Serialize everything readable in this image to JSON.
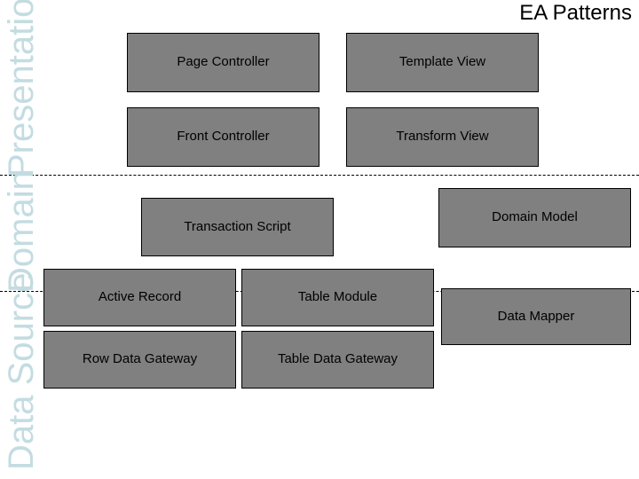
{
  "slide": {
    "title": "EA Patterns",
    "background_color": "#ffffff",
    "box_fill_color": "#808080",
    "box_border_color": "#000000",
    "band_label_color": "#c3dce1",
    "title_color": "#000000"
  },
  "bands": [
    {
      "id": "presentation",
      "label": "Presentation"
    },
    {
      "id": "domain",
      "label": "Domain"
    },
    {
      "id": "data-source",
      "label": "Data Source"
    }
  ],
  "separators": [
    {
      "id": "presentation-domain-divider",
      "style": "dashed"
    },
    {
      "id": "domain-datasource-divider",
      "style": "dashed"
    }
  ],
  "patterns": {
    "presentation": [
      {
        "id": "page-controller",
        "label": "Page Controller"
      },
      {
        "id": "template-view",
        "label": "Template View"
      },
      {
        "id": "front-controller",
        "label": "Front Controller"
      },
      {
        "id": "transform-view",
        "label": "Transform View"
      }
    ],
    "domain": [
      {
        "id": "transaction-script",
        "label": "Transaction Script"
      },
      {
        "id": "domain-model",
        "label": "Domain Model"
      }
    ],
    "data_source": [
      {
        "id": "active-record",
        "label": "Active Record"
      },
      {
        "id": "table-module",
        "label": "Table Module"
      },
      {
        "id": "data-mapper",
        "label": "Data Mapper"
      },
      {
        "id": "row-data-gateway",
        "label": "Row Data Gateway"
      },
      {
        "id": "table-data-gateway",
        "label": "Table Data Gateway"
      }
    ]
  }
}
